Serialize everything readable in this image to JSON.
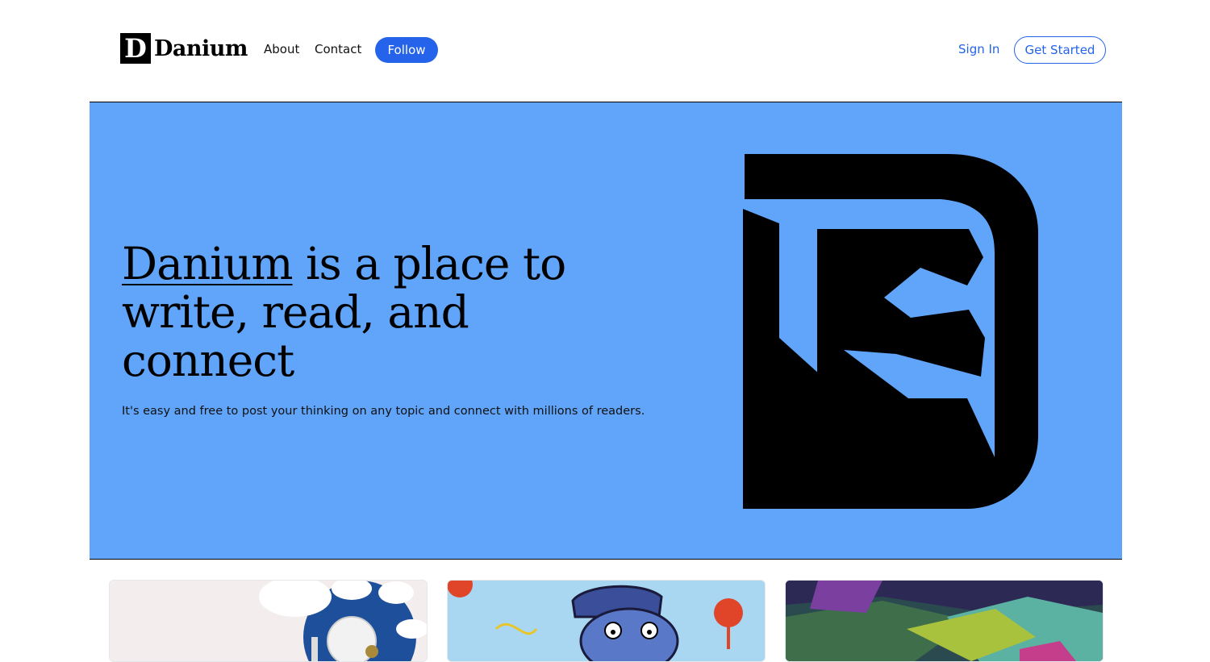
{
  "header": {
    "logo_letter": "D",
    "logo_text": "Danium",
    "nav": {
      "about": "About",
      "contact": "Contact",
      "follow": "Follow"
    },
    "sign_in": "Sign In",
    "get_started": "Get Started"
  },
  "hero": {
    "title_brand": "Danium",
    "title_rest": " is a place to write, read, and connect",
    "subtitle": "It's easy and free to post your thinking on any topic and connect with millions of readers."
  },
  "cards": [
    {
      "image": "white-abstract-sculpture-image"
    },
    {
      "image": "blue-graffiti-face-image"
    },
    {
      "image": "colorful-abstract-painting-image"
    }
  ],
  "colors": {
    "accent": "#2563eb",
    "hero_bg": "#60a5fa"
  }
}
